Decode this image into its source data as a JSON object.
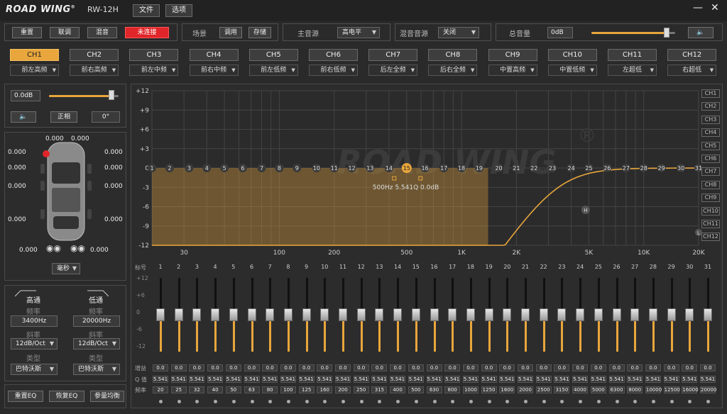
{
  "app": {
    "logo": "ROAD WING",
    "model": "RW-12H",
    "menu_file": "文件",
    "menu_options": "选项",
    "min_icon": "—",
    "close_icon": "✕"
  },
  "toolbar": {
    "reset": "重置",
    "link": "联调",
    "mix": "混音",
    "status": "未连接",
    "scene_label": "场景",
    "scene_call": "调用",
    "scene_save": "存储",
    "main_source_label": "主音源",
    "main_source_value": "高电平",
    "mix_source_label": "混音音源",
    "mix_source_value": "关闭",
    "master_label": "总音量",
    "master_value": "0dB",
    "master_level": 0.9
  },
  "channels": [
    {
      "name": "CH1",
      "pos": "前左高频"
    },
    {
      "name": "CH2",
      "pos": "前右高频"
    },
    {
      "name": "CH3",
      "pos": "前左中频"
    },
    {
      "name": "CH4",
      "pos": "前右中频"
    },
    {
      "name": "CH5",
      "pos": "前左低频"
    },
    {
      "name": "CH6",
      "pos": "前右低频"
    },
    {
      "name": "CH7",
      "pos": "后左全频"
    },
    {
      "name": "CH8",
      "pos": "后右全频"
    },
    {
      "name": "CH9",
      "pos": "中置高频"
    },
    {
      "name": "CH10",
      "pos": "中置低频"
    },
    {
      "name": "CH11",
      "pos": "左超低"
    },
    {
      "name": "CH12",
      "pos": "右超低"
    }
  ],
  "active_channel": 0,
  "channel_ctrl": {
    "gain": "0.0dB",
    "gain_level": 0.9,
    "phase_label": "正相",
    "phase_value": "0°"
  },
  "delay": {
    "values": [
      "0.000",
      "0.000",
      "0.000",
      "0.000",
      "0.000",
      "0.000",
      "0.000",
      "0.000",
      "0.000",
      "0.000",
      "0.000",
      "0.000"
    ],
    "unit": "毫秒"
  },
  "crossover": {
    "hp_title": "高通",
    "lp_title": "低通",
    "freq_label": "频率",
    "hp_freq": "3400Hz",
    "lp_freq": "20000Hz",
    "slope_label": "斜率",
    "hp_slope": "12dB/Oct",
    "lp_slope": "12dB/Oct",
    "type_label": "类型",
    "hp_type": "巴特沃斯",
    "lp_type": "巴特沃斯"
  },
  "eq_buttons": {
    "reset": "重置EQ",
    "restore": "恢复EQ",
    "param": "参量均衡"
  },
  "chart_data": {
    "type": "line",
    "ylim": [
      -12,
      12
    ],
    "y_ticks": [
      "+12",
      "+9",
      "+6",
      "+3",
      "0",
      "-3",
      "-6",
      "-9",
      "-12"
    ],
    "x_ticks": [
      "30",
      "100",
      "200",
      "500",
      "1K",
      "2K",
      "5K",
      "10K",
      "20K"
    ],
    "x_ticks_hz": [
      30,
      100,
      200,
      500,
      1000,
      2000,
      5000,
      10000,
      20000
    ],
    "xlim_hz": [
      20,
      20000
    ],
    "band_markers": [
      1,
      2,
      3,
      4,
      5,
      6,
      7,
      8,
      9,
      10,
      11,
      12,
      13,
      14,
      15,
      16,
      17,
      18,
      19,
      20,
      21,
      22,
      23,
      24,
      25,
      26,
      27,
      28,
      29,
      30,
      31
    ],
    "selected_band": 15,
    "tooltip": "500Hz  5.541Q  0.0dB",
    "highpass_hz": 3400,
    "filter_markers": [
      "H",
      "L"
    ],
    "watermark": "ROAD WING",
    "channel_tags": [
      "CH1",
      "CH2",
      "CH3",
      "CH4",
      "CH5",
      "CH6",
      "CH7",
      "CH8",
      "CH9",
      "CH10",
      "CH11",
      "CH12"
    ]
  },
  "faders": {
    "label_title": "标号",
    "scale": [
      "+12",
      "+6",
      "0",
      "-6",
      "-12"
    ],
    "gain_label": "增益",
    "q_label": "Q 值",
    "freq_label": "频率",
    "bands": [
      {
        "n": "1",
        "g": "0.0",
        "q": "5.541",
        "f": "20"
      },
      {
        "n": "2",
        "g": "0.0",
        "q": "5.541",
        "f": "25"
      },
      {
        "n": "3",
        "g": "0.0",
        "q": "5.541",
        "f": "32"
      },
      {
        "n": "4",
        "g": "0.0",
        "q": "5.541",
        "f": "40"
      },
      {
        "n": "5",
        "g": "0.0",
        "q": "5.541",
        "f": "50"
      },
      {
        "n": "6",
        "g": "0.0",
        "q": "5.541",
        "f": "63"
      },
      {
        "n": "7",
        "g": "0.0",
        "q": "5.541",
        "f": "80"
      },
      {
        "n": "8",
        "g": "0.0",
        "q": "5.541",
        "f": "100"
      },
      {
        "n": "9",
        "g": "0.0",
        "q": "5.541",
        "f": "125"
      },
      {
        "n": "10",
        "g": "0.0",
        "q": "5.541",
        "f": "160"
      },
      {
        "n": "11",
        "g": "0.0",
        "q": "5.541",
        "f": "200"
      },
      {
        "n": "12",
        "g": "0.0",
        "q": "5.541",
        "f": "250"
      },
      {
        "n": "13",
        "g": "0.0",
        "q": "5.541",
        "f": "315"
      },
      {
        "n": "14",
        "g": "0.0",
        "q": "5.541",
        "f": "400"
      },
      {
        "n": "15",
        "g": "0.0",
        "q": "5.541",
        "f": "500"
      },
      {
        "n": "16",
        "g": "0.0",
        "q": "5.541",
        "f": "630"
      },
      {
        "n": "17",
        "g": "0.0",
        "q": "5.541",
        "f": "800"
      },
      {
        "n": "18",
        "g": "0.0",
        "q": "5.541",
        "f": "1000"
      },
      {
        "n": "19",
        "g": "0.0",
        "q": "5.541",
        "f": "1250"
      },
      {
        "n": "20",
        "g": "0.0",
        "q": "5.541",
        "f": "1600"
      },
      {
        "n": "21",
        "g": "0.0",
        "q": "5.541",
        "f": "2000"
      },
      {
        "n": "22",
        "g": "0.0",
        "q": "5.541",
        "f": "2500"
      },
      {
        "n": "23",
        "g": "0.0",
        "q": "5.541",
        "f": "3150"
      },
      {
        "n": "24",
        "g": "0.0",
        "q": "5.541",
        "f": "4000"
      },
      {
        "n": "25",
        "g": "0.0",
        "q": "5.541",
        "f": "5000"
      },
      {
        "n": "26",
        "g": "0.0",
        "q": "5.541",
        "f": "6300"
      },
      {
        "n": "27",
        "g": "0.0",
        "q": "5.541",
        "f": "8000"
      },
      {
        "n": "28",
        "g": "0.0",
        "q": "5.541",
        "f": "10000"
      },
      {
        "n": "29",
        "g": "0.0",
        "q": "5.541",
        "f": "12500"
      },
      {
        "n": "30",
        "g": "0.0",
        "q": "5.541",
        "f": "16000"
      },
      {
        "n": "31",
        "g": "0.0",
        "q": "5.541",
        "f": "20000"
      }
    ]
  },
  "colors": {
    "accent": "#e8a63c",
    "alert": "#e0262a"
  }
}
